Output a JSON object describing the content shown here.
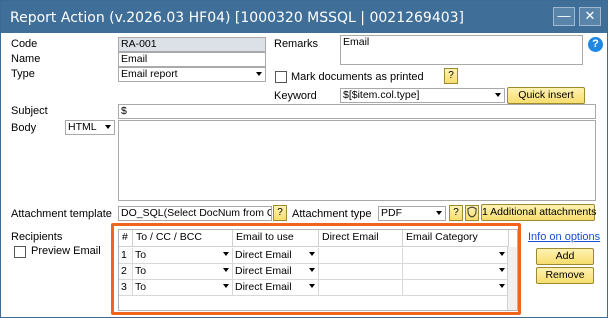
{
  "window": {
    "title": "Report Action (v.2026.03 HF04) [1000320 MSSQL | 0021269403]",
    "minimize_label": "—",
    "close_label": "✕",
    "help_label": "?"
  },
  "form": {
    "code_label": "Code",
    "code_value": "RA-001",
    "name_label": "Name",
    "name_value": "Email",
    "type_label": "Type",
    "type_value": "Email report",
    "remarks_label": "Remarks",
    "remarks_value": "Email",
    "mark_printed_label": "Mark documents as printed",
    "mark_printed_checked": false,
    "mark_help": "?",
    "keyword_label": "Keyword",
    "keyword_value": "$[$item.col.type]",
    "quick_insert_label": "Quick insert",
    "subject_label": "Subject",
    "subject_value": "$",
    "body_label": "Body",
    "body_format": "HTML",
    "body_value": "",
    "attachment_template_label": "Attachment template",
    "attachment_template_value": "DO_SQL(Select DocNum from ODLN",
    "attachment_template_help": "?",
    "attachment_type_label": "Attachment type",
    "attachment_type_value": "PDF",
    "attachment_type_help": "?",
    "attachment_icon": "shield-icon",
    "additional_attachments_label": "1 Additional attachments"
  },
  "recipients": {
    "label": "Recipients",
    "preview_email_label": "Preview Email",
    "preview_email_checked": false,
    "info_link": "Info on options",
    "add_label": "Add",
    "remove_label": "Remove",
    "columns": [
      "#",
      "To / CC / BCC",
      "Email to use",
      "Direct Email",
      "Email Category"
    ],
    "rows": [
      {
        "num": "1",
        "to": "To",
        "email_to_use": "Direct Email",
        "direct_email": "",
        "category": ""
      },
      {
        "num": "2",
        "to": "To",
        "email_to_use": "Direct Email",
        "direct_email": "",
        "category": ""
      },
      {
        "num": "3",
        "to": "To",
        "email_to_use": "Direct Email",
        "direct_email": "",
        "category": ""
      }
    ]
  },
  "colors": {
    "titlebar": "#3f6f98",
    "highlight": "#f0641e",
    "button": "#f7dd6e",
    "link": "#1a4dcc"
  }
}
